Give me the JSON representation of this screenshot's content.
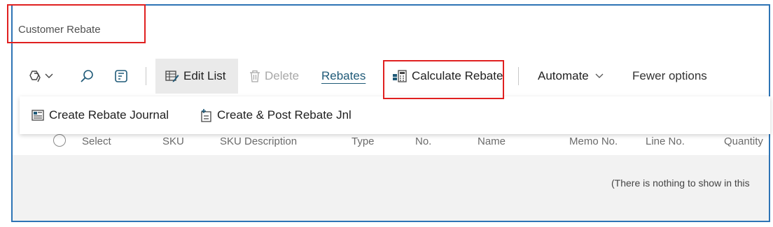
{
  "page": {
    "title": "Customer Rebate"
  },
  "toolbar": {
    "edit_list": "Edit List",
    "delete": "Delete",
    "rebates": "Rebates",
    "calculate_rebate": "Calculate Rebate",
    "automate": "Automate",
    "fewer_options": "Fewer options"
  },
  "flyout": {
    "create_rebate_journal": "Create Rebate Journal",
    "create_post_rebate_jnl": "Create & Post Rebate Jnl"
  },
  "list": {
    "columns": [
      "Select",
      "SKU",
      "SKU Description",
      "Type",
      "No.",
      "Name",
      "Memo No.",
      "Line No.",
      "Quantity"
    ],
    "empty_message": "(There is nothing to show in this"
  },
  "colors": {
    "accent": "#1f5a78",
    "highlight": "#e02020",
    "frame": "#2e74b5"
  }
}
